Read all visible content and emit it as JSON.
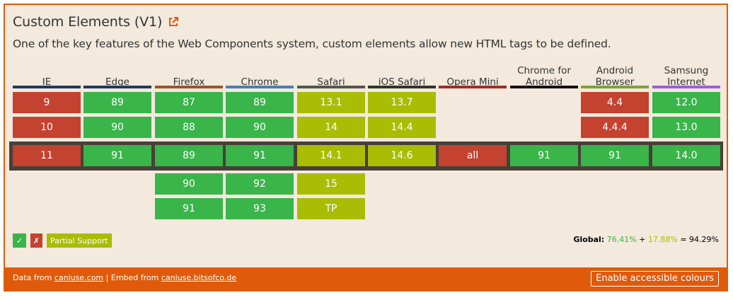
{
  "feature": {
    "title": "Custom Elements (V1)",
    "description": "One of the key features of the Web Components system, custom elements allow new HTML tags to be defined."
  },
  "browsers": [
    {
      "name": "IE",
      "color": "#1f3a5c"
    },
    {
      "name": "Edge",
      "color": "#1f3a5c"
    },
    {
      "name": "Firefox",
      "color": "#a0522d"
    },
    {
      "name": "Chrome",
      "color": "#4a7fb5"
    },
    {
      "name": "Safari",
      "color": "#555555"
    },
    {
      "name": "iOS Safari",
      "color": "#333333"
    },
    {
      "name": "Opera Mini",
      "color": "#a52a2a"
    },
    {
      "name": "Chrome for Android",
      "color": "#111111"
    },
    {
      "name": "Android Browser",
      "color": "#7aa33a"
    },
    {
      "name": "Samsung Internet",
      "color": "#9b5de5"
    }
  ],
  "versions": {
    "IE": {
      "past": [
        [
          "9",
          "n"
        ],
        [
          "10",
          "n"
        ]
      ],
      "current": [
        "11",
        "n"
      ],
      "future": []
    },
    "Edge": {
      "past": [
        [
          "89",
          "y"
        ],
        [
          "90",
          "y"
        ]
      ],
      "current": [
        "91",
        "y"
      ],
      "future": []
    },
    "Firefox": {
      "past": [
        [
          "87",
          "y"
        ],
        [
          "88",
          "y"
        ]
      ],
      "current": [
        "89",
        "y"
      ],
      "future": [
        [
          "90",
          "y"
        ],
        [
          "91",
          "y"
        ]
      ]
    },
    "Chrome": {
      "past": [
        [
          "89",
          "y"
        ],
        [
          "90",
          "y"
        ]
      ],
      "current": [
        "91",
        "y"
      ],
      "future": [
        [
          "92",
          "y"
        ],
        [
          "93",
          "y"
        ]
      ]
    },
    "Safari": {
      "past": [
        [
          "13.1",
          "a"
        ],
        [
          "14",
          "a"
        ]
      ],
      "current": [
        "14.1",
        "a"
      ],
      "future": [
        [
          "15",
          "a"
        ],
        [
          "TP",
          "a"
        ]
      ]
    },
    "iOS Safari": {
      "past": [
        [
          "13.7",
          "a"
        ],
        [
          "14.4",
          "a"
        ]
      ],
      "current": [
        "14.6",
        "a"
      ],
      "future": []
    },
    "Opera Mini": {
      "past": [],
      "current": [
        "all",
        "n"
      ],
      "future": []
    },
    "Chrome for Android": {
      "past": [],
      "current": [
        "91",
        "y"
      ],
      "future": []
    },
    "Android Browser": {
      "past": [
        [
          "4.4",
          "n"
        ],
        [
          "4.4.4",
          "n"
        ]
      ],
      "current": [
        "91",
        "y"
      ],
      "future": []
    },
    "Samsung Internet": {
      "past": [
        [
          "12.0",
          "y"
        ],
        [
          "13.0",
          "y"
        ]
      ],
      "current": [
        "14.0",
        "y"
      ],
      "future": []
    }
  },
  "legend": {
    "supported_symbol": "✓",
    "unsupported_symbol": "✗",
    "partial_label": "Partial Support"
  },
  "global": {
    "label": "Global:",
    "full": "76.41%",
    "plus": "+",
    "partial": "17.88%",
    "equals": "=",
    "total": "94.29%"
  },
  "footer": {
    "data_from": "Data from",
    "data_link": "caniuse.com",
    "separator": "|",
    "embed_from": "Embed from",
    "embed_link": "caniuse.bitsofco.de",
    "accessible_button": "Enable accessible colours"
  },
  "colors": {
    "supported": "#39b54a",
    "unsupported": "#c44230",
    "partial": "#a8bd04",
    "accent": "#df5b0b",
    "background": "#f3e9dc"
  }
}
